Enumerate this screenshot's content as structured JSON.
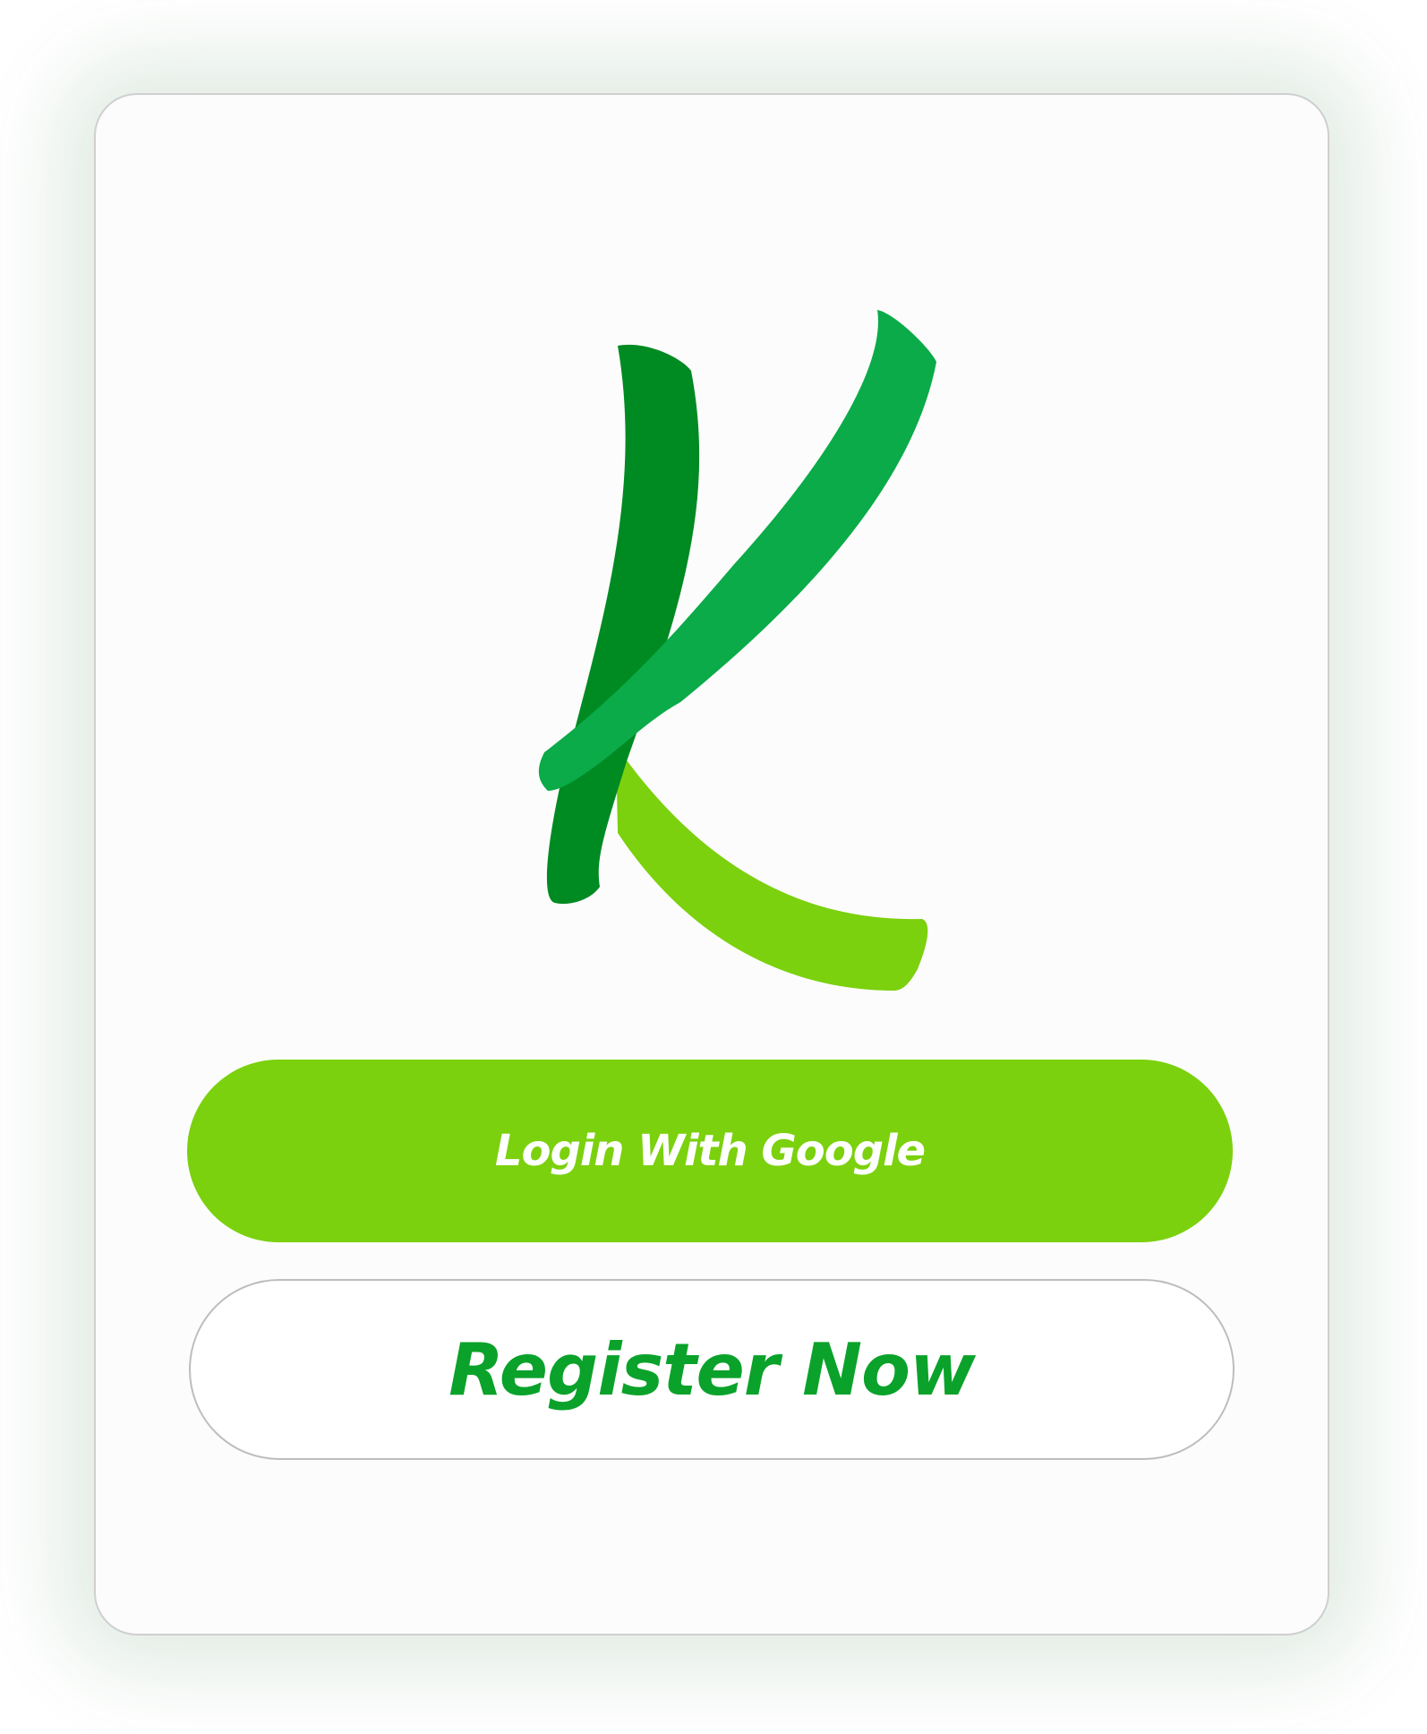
{
  "brand": {
    "logo_icon": "k-letter-logo-icon",
    "colors": {
      "dark_green": "#008a22",
      "mid_green": "#0aab48",
      "light_green": "#7bd10d",
      "register_text": "#0aa22a"
    }
  },
  "actions": {
    "google_login_label": "Login With Google",
    "register_label": "Register Now"
  }
}
